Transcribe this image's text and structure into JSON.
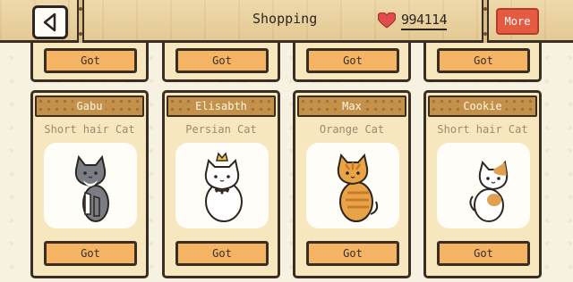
{
  "header": {
    "title": "Shopping",
    "currency": "994114",
    "more_label": "More"
  },
  "top_row": [
    {
      "button_label": "Got"
    },
    {
      "button_label": "Got"
    },
    {
      "button_label": "Got"
    },
    {
      "button_label": "Got"
    }
  ],
  "cats": [
    {
      "name": "Gabu",
      "breed": "Short hair Cat",
      "button_label": "Got",
      "color": "#7a7d84"
    },
    {
      "name": "Elisabth",
      "breed": "Persian Cat",
      "button_label": "Got",
      "color": "#ffffff"
    },
    {
      "name": "Max",
      "breed": "Orange Cat",
      "button_label": "Got",
      "color": "#e9a447"
    },
    {
      "name": "Cookie",
      "breed": "Short hair Cat",
      "button_label": "Got",
      "color": "#e0a051"
    }
  ],
  "colors": {
    "header_wood": "#e9d3a3",
    "card_bg": "#f7e7bf",
    "button": "#f5b463",
    "name_bar": "#c4914b",
    "more_button": "#e55b42",
    "heart": "#e34c4c"
  },
  "icons": [
    "back-arrow-icon",
    "heart-icon"
  ]
}
